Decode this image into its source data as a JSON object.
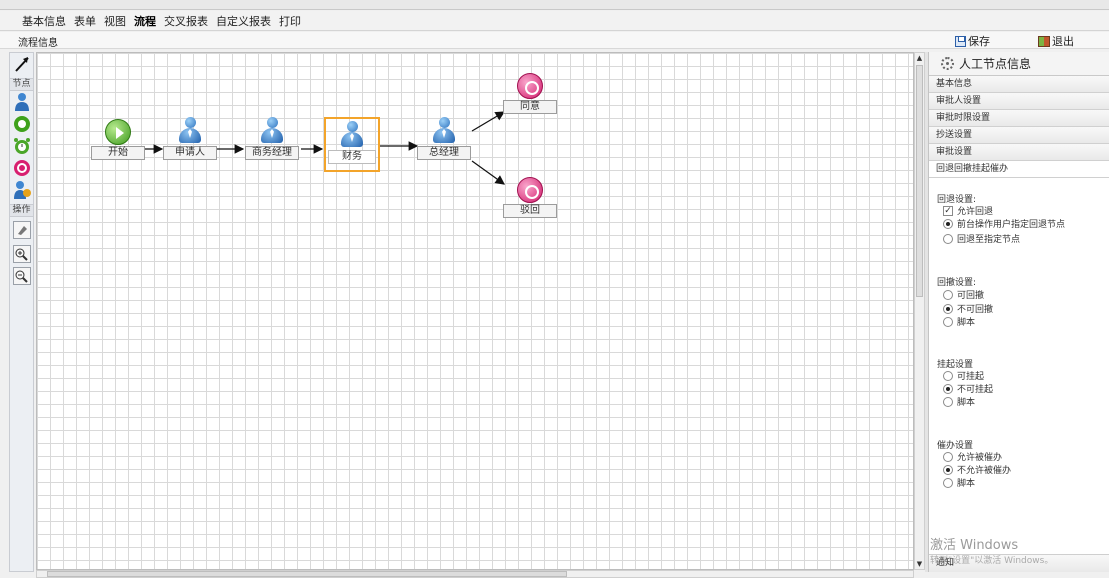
{
  "tabs": [
    "基本信息",
    "表单",
    "视图",
    "流程",
    "交叉报表",
    "自定义报表",
    "打印"
  ],
  "active_tab": "流程",
  "toolbar": {
    "title": "流程信息",
    "save_label": "保存",
    "exit_label": "退出"
  },
  "palette": {
    "nodes_header": "节点",
    "ops_header": "操作"
  },
  "flow": {
    "nodes": {
      "start": "开始",
      "applicant": "申请人",
      "biz_manager": "商务经理",
      "finance": "财务",
      "gm": "总经理",
      "approve": "同意",
      "reject": "驳回"
    }
  },
  "panel": {
    "title": "人工节点信息",
    "sections": [
      "基本信息",
      "审批人设置",
      "审批时限设置",
      "抄送设置",
      "审批设置",
      "回退回撤挂起催办"
    ],
    "rollback": {
      "label": "回退设置:",
      "allow": "允许回退",
      "opt1": "前台操作用户指定回退节点",
      "opt2": "回退至指定节点"
    },
    "withdraw": {
      "label": "回撤设置:",
      "opt1": "可回撤",
      "opt2": "不可回撤",
      "opt3": "脚本"
    },
    "suspend": {
      "label": "挂起设置",
      "opt1": "可挂起",
      "opt2": "不可挂起",
      "opt3": "脚本"
    },
    "urge": {
      "label": "催办设置",
      "opt1": "允许被催办",
      "opt2": "不允许被催办",
      "opt3": "脚本"
    },
    "notify": "通知"
  },
  "watermark": {
    "line1": "激活 Windows",
    "line2": "转到\"设置\"以激活 Windows。"
  }
}
